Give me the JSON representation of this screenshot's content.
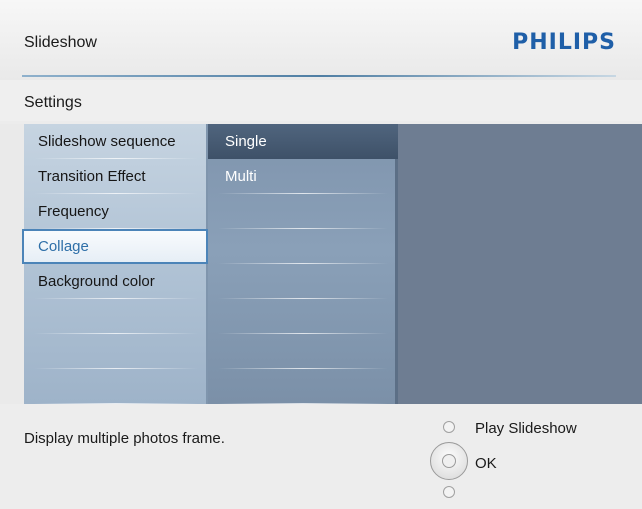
{
  "header": {
    "title": "Slideshow",
    "brand": "PHILIPS"
  },
  "subheader": {
    "label": "Settings"
  },
  "menu": {
    "items": [
      {
        "label": "Slideshow sequence"
      },
      {
        "label": "Transition Effect"
      },
      {
        "label": "Frequency"
      },
      {
        "label": "Collage",
        "selected": true
      },
      {
        "label": "Background color"
      }
    ]
  },
  "options": {
    "items": [
      {
        "label": "Single",
        "selected": true
      },
      {
        "label": "Multi"
      }
    ]
  },
  "footer": {
    "description": "Display multiple photos frame.",
    "play_label": "Play Slideshow",
    "ok_label": "OK"
  },
  "colors": {
    "brand": "#1f5fa8",
    "selected_text": "#2e6fa8",
    "panel_bg": "#6e7d92"
  }
}
